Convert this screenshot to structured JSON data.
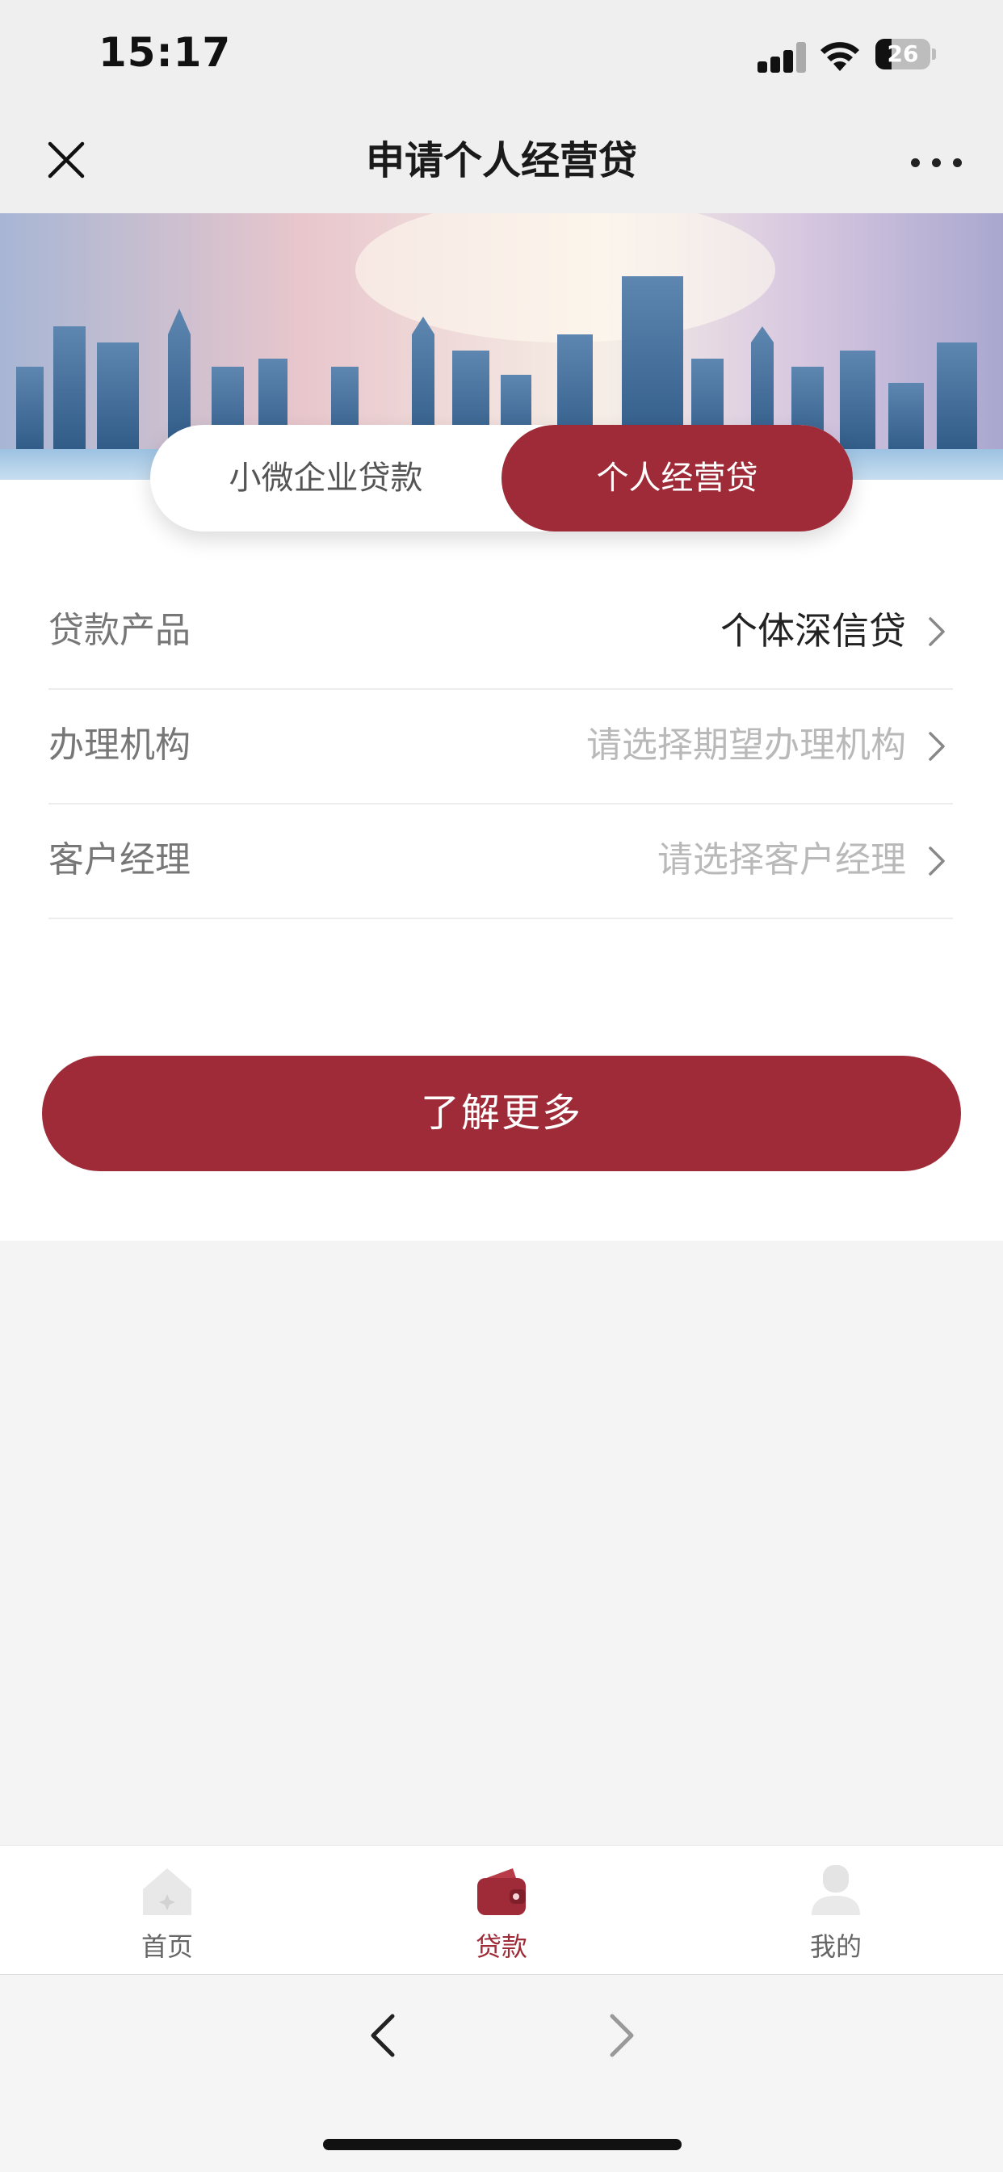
{
  "status_bar": {
    "time": "15:17",
    "battery": "26"
  },
  "nav": {
    "title": "申请个人经营贷"
  },
  "segments": {
    "left": "小微企业贷款",
    "right": "个人经营贷",
    "active": "right"
  },
  "form": {
    "rows": [
      {
        "label": "贷款产品",
        "value": "个体深信贷",
        "state": "filled"
      },
      {
        "label": "办理机构",
        "value": "请选择期望办理机构",
        "state": "placeholder"
      },
      {
        "label": "客户经理",
        "value": "请选择客户经理",
        "state": "placeholder"
      }
    ]
  },
  "primary_button": {
    "label": "了解更多"
  },
  "tabbar": {
    "items": [
      {
        "label": "首页",
        "icon": "home-icon",
        "active": false
      },
      {
        "label": "贷款",
        "icon": "wallet-icon",
        "active": true
      },
      {
        "label": "我的",
        "icon": "user-icon",
        "active": false
      }
    ]
  },
  "colors": {
    "brand": "#9e2b37",
    "placeholder": "#b9b9b9",
    "label": "#777777"
  }
}
